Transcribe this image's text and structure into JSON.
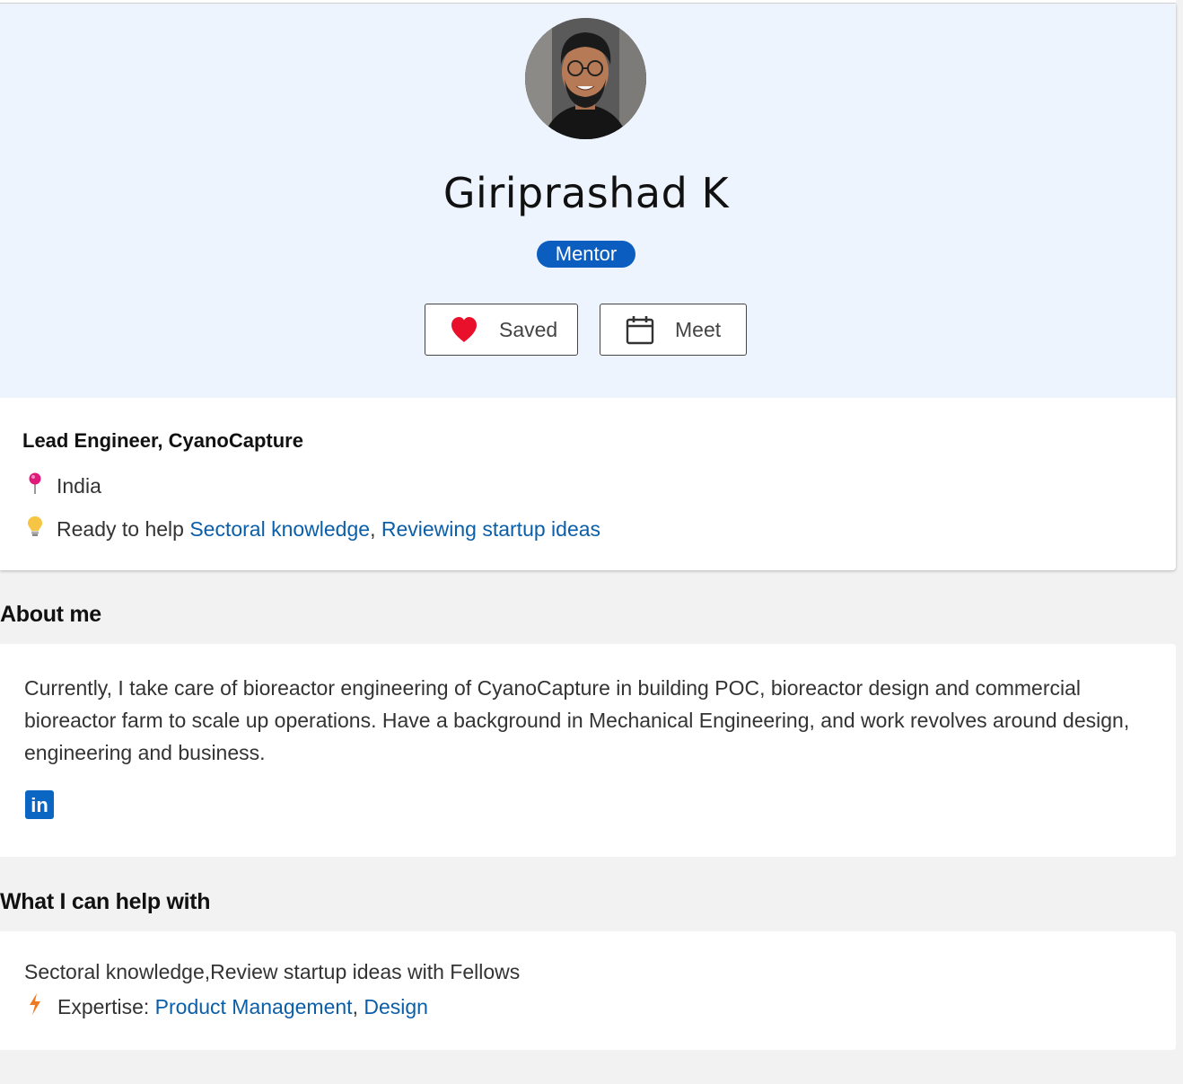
{
  "profile": {
    "name": "Giriprashad K",
    "badge": "Mentor",
    "role": "Lead Engineer, CyanoCapture",
    "location": "India",
    "ready_prefix": "Ready to help",
    "ready_items": [
      "Sectoral knowledge",
      "Reviewing startup ideas"
    ],
    "ready_sep": ","
  },
  "actions": {
    "saved_label": "Saved",
    "meet_label": "Meet"
  },
  "about": {
    "title": "About me",
    "text": "Currently, I take care of bioreactor engineering of CyanoCapture in building POC, bioreactor design and commercial bioreactor farm to scale up operations. Have a background in Mechanical Engineering, and work revolves around design, engineering and business.",
    "linkedin_label": "in"
  },
  "help": {
    "title": "What I can help with",
    "text": "Sectoral knowledge,Review startup ideas with Fellows",
    "expertise_prefix": "Expertise:",
    "expertise_items": [
      "Product Management",
      "Design"
    ],
    "expertise_sep": ","
  },
  "icons": {
    "heart": "heart-icon",
    "calendar": "calendar-icon",
    "pin": "pushpin-icon",
    "bulb": "lightbulb-icon",
    "bolt": "lightning-icon",
    "linkedin": "linkedin-icon"
  },
  "colors": {
    "hero_bg": "#edf4fe",
    "badge_bg": "#0b5ec0",
    "link": "#0b5ea8",
    "heart": "#e8102a"
  }
}
